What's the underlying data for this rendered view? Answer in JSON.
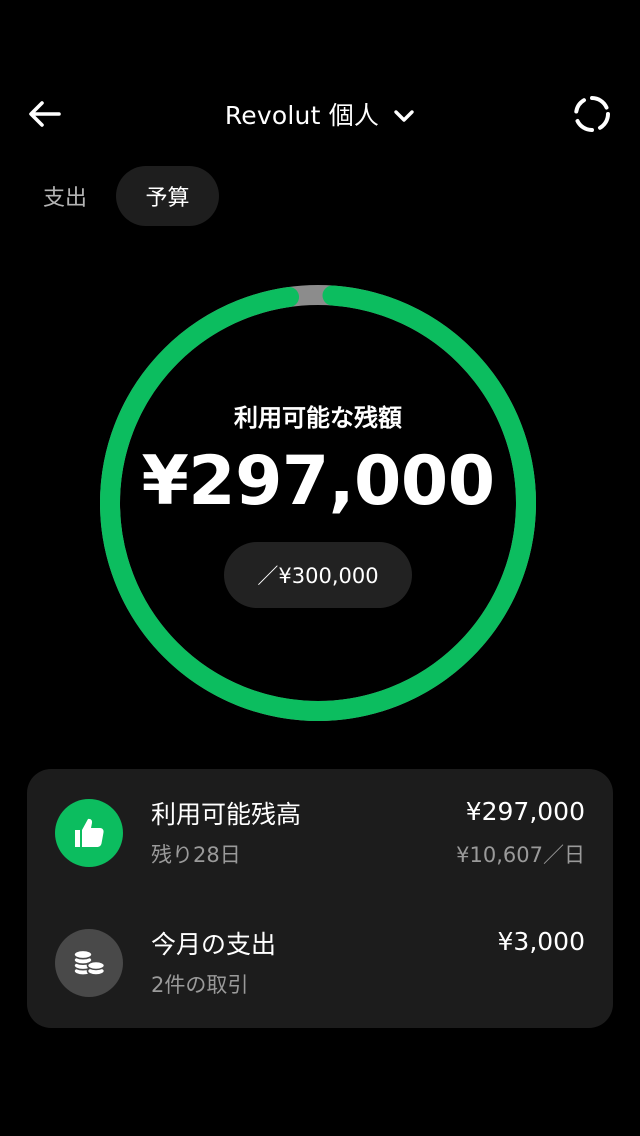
{
  "header": {
    "title": "Revolut 個人",
    "icons": {
      "back": "arrow-left-icon",
      "dropdown": "chevron-down-icon",
      "refresh": "loading-ring-icon"
    }
  },
  "tabs": [
    {
      "label": "支出",
      "selected": false
    },
    {
      "label": "予算",
      "selected": true
    }
  ],
  "budget": {
    "label": "利用可能な残額",
    "amount": "¥297,000",
    "total": "／¥300,000",
    "remaining_fraction": 0.99,
    "colors": {
      "remaining": "#0cbd5f",
      "spent": "#8c8c8c"
    }
  },
  "summary": {
    "rows": [
      {
        "icon": "thumbs-up-icon",
        "title": "利用可能残高",
        "subtitle": "残り28日",
        "amount": "¥297,000",
        "rate": "¥10,607／日",
        "icon_color": "#0cbd5f"
      },
      {
        "icon": "coins-icon",
        "title": "今月の支出",
        "subtitle": "2件の取引",
        "amount": "¥3,000",
        "icon_color": "#494949"
      }
    ]
  }
}
